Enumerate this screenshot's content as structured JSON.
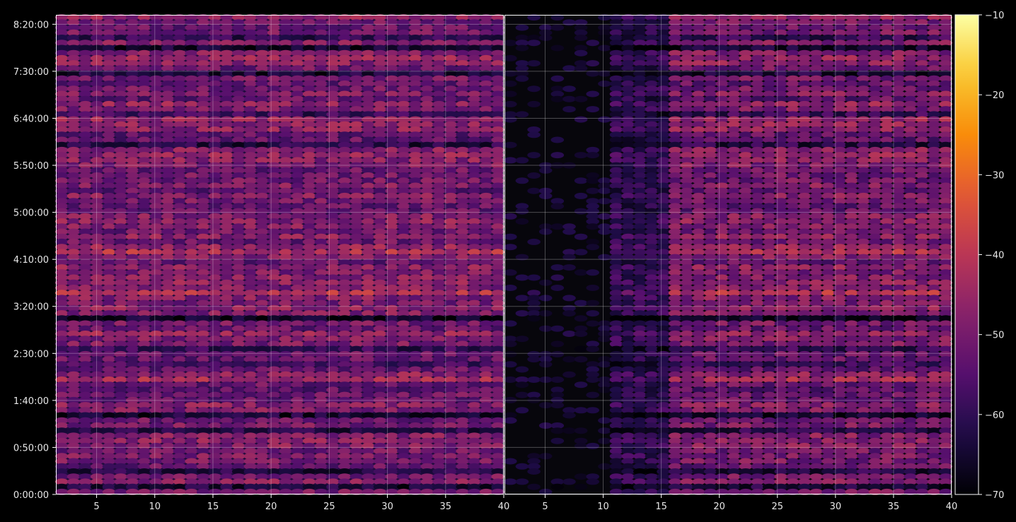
{
  "chart_data": {
    "type": "heatmap",
    "background": "#000000",
    "colormap": "inferno",
    "panels": [
      {
        "x_range": [
          1.5,
          40
        ],
        "x_ticks": [
          5,
          10,
          15,
          20,
          25,
          30,
          35,
          40
        ],
        "content": "full"
      },
      {
        "x_range": [
          1.5,
          40
        ],
        "x_ticks": [
          5,
          10,
          15,
          20,
          25,
          30,
          35,
          40
        ],
        "content": "left-third-dark"
      }
    ],
    "y_axis": {
      "unit": "seconds",
      "range": [
        0,
        30600
      ],
      "ticks": [
        {
          "value": 0,
          "label": "0:00:00"
        },
        {
          "value": 3000,
          "label": "0:50:00"
        },
        {
          "value": 6000,
          "label": "1:40:00"
        },
        {
          "value": 9000,
          "label": "2:30:00"
        },
        {
          "value": 12000,
          "label": "3:20:00"
        },
        {
          "value": 15000,
          "label": "4:10:00"
        },
        {
          "value": 18000,
          "label": "5:00:00"
        },
        {
          "value": 21000,
          "label": "5:50:00"
        },
        {
          "value": 24000,
          "label": "6:40:00"
        },
        {
          "value": 27000,
          "label": "7:30:00"
        },
        {
          "value": 30000,
          "label": "8:20:00"
        }
      ]
    },
    "colorbar": {
      "range": [
        -70,
        -10
      ],
      "ticks": [
        -10,
        -20,
        -30,
        -40,
        -50,
        -60,
        -70
      ],
      "tick_labels": [
        "−10",
        "−20",
        "−30",
        "−40",
        "−50",
        "−60",
        "−70"
      ]
    },
    "grid": true,
    "x_bins": 38,
    "y_bins": 94,
    "value_range": [
      -70,
      -22
    ]
  }
}
